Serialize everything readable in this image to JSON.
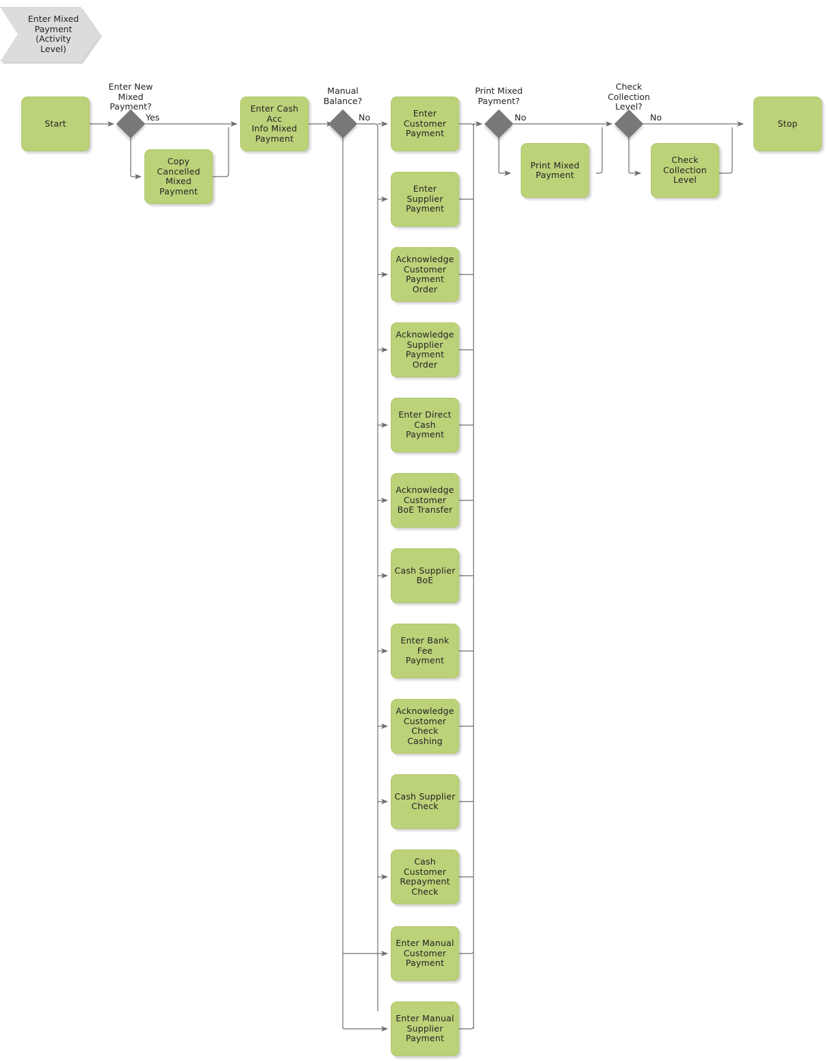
{
  "diagram": {
    "title": "Enter Mixed Payment (Activity Level)",
    "banner_label": "Enter Mixed\nPayment\n(Activity\nLevel)",
    "colors": {
      "activity_fill": "#BCD279",
      "decision_fill": "#787878",
      "banner_fill": "#DCDCDC",
      "edge_stroke": "#6E6E6E",
      "text": "#232323"
    }
  },
  "nodes": {
    "start": {
      "label": "Start",
      "type": "terminator"
    },
    "copy_cancelled": {
      "label": "Copy Cancelled\nMixed Payment",
      "type": "activity"
    },
    "enter_cash_acc": {
      "label": "Enter Cash Acc\nInfo Mixed\nPayment",
      "type": "activity"
    },
    "print_mixed_payment": {
      "label": "Print Mixed\nPayment",
      "type": "activity"
    },
    "check_collection_level": {
      "label": "Check\nCollection\nLevel",
      "type": "activity"
    },
    "stop": {
      "label": "Stop",
      "type": "terminator"
    }
  },
  "decisions": [
    {
      "id": "enter-new-mixed-payment",
      "question": "Enter New\nMixed\nPayment?",
      "yes_label": "Yes"
    },
    {
      "id": "manual-balance",
      "question": "Manual\nBalance?",
      "no_label": "No"
    },
    {
      "id": "print-mixed-payment",
      "question": "Print Mixed\nPayment?",
      "no_label": "No"
    },
    {
      "id": "check-collection-level",
      "question": "Check\nCollection\nLevel?",
      "no_label": "No"
    }
  ],
  "branch_activities": [
    {
      "label": "Enter\nCustomer\nPayment"
    },
    {
      "label": "Enter\nSupplier\nPayment"
    },
    {
      "label": "Acknowledge\nCustomer\nPayment Order"
    },
    {
      "label": "Acknowledge\nSupplier\nPayment\nOrder"
    },
    {
      "label": "Enter Direct\nCash Payment"
    },
    {
      "label": "Acknowledge\nCustomer\nBoE Transfer"
    },
    {
      "label": "Cash Supplier\nBoE"
    },
    {
      "label": "Enter Bank\nFee\nPayment"
    },
    {
      "label": "Acknowledge\nCustomer Check\nCashing"
    },
    {
      "label": "Cash Supplier\nCheck"
    },
    {
      "label": "Cash Customer\nRepayment\nCheck"
    },
    {
      "label": "Enter Manual\nCustomer\nPayment"
    },
    {
      "label": "Enter Manual\nSupplier\nPayment"
    }
  ]
}
